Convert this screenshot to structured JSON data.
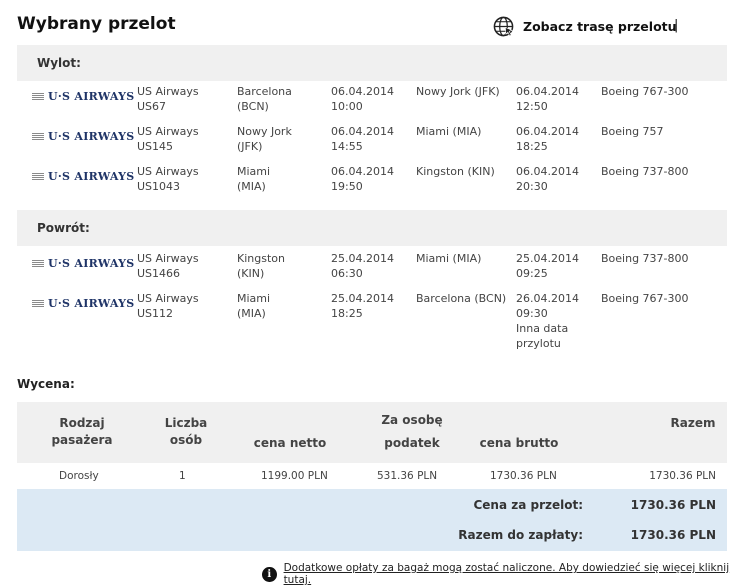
{
  "header": {
    "title": "Wybrany przelot",
    "route_link": "Zobacz trasę przelotu",
    "separator": "|"
  },
  "outbound": {
    "label": "Wylot:",
    "flights": [
      {
        "logo": "U·S AIRWAYS",
        "airline": "US Airways\nUS67",
        "from": "Barcelona\n(BCN)",
        "dep": "06.04.2014\n10:00",
        "to": "Nowy Jork (JFK)",
        "arr": "06.04.2014\n12:50",
        "aircraft": "Boeing 767-300"
      },
      {
        "logo": "U·S AIRWAYS",
        "airline": "US Airways\nUS145",
        "from": "Nowy Jork\n(JFK)",
        "dep": "06.04.2014\n14:55",
        "to": "Miami (MIA)",
        "arr": "06.04.2014\n18:25",
        "aircraft": "Boeing 757"
      },
      {
        "logo": "U·S AIRWAYS",
        "airline": "US Airways\nUS1043",
        "from": "Miami\n(MIA)",
        "dep": "06.04.2014\n19:50",
        "to": "Kingston (KIN)",
        "arr": "06.04.2014\n20:30",
        "aircraft": "Boeing 737-800"
      }
    ]
  },
  "return": {
    "label": "Powrót:",
    "flights": [
      {
        "logo": "U·S AIRWAYS",
        "airline": "US Airways\nUS1466",
        "from": "Kingston\n(KIN)",
        "dep": "25.04.2014\n06:30",
        "to": "Miami (MIA)",
        "arr": "25.04.2014\n09:25",
        "aircraft": "Boeing 737-800"
      },
      {
        "logo": "U·S AIRWAYS",
        "airline": "US Airways\nUS112",
        "from": "Miami\n(MIA)",
        "dep": "25.04.2014\n18:25",
        "to": "Barcelona (BCN)",
        "arr": "26.04.2014\n09:30\nInna data\nprzylotu",
        "aircraft": "Boeing 767-300"
      }
    ]
  },
  "pricing": {
    "label": "Wycena:",
    "headers": {
      "passenger_type": "Rodzaj\npasażera",
      "count": "Liczba\nosób",
      "per_person": "Za osobę",
      "net": "cena netto",
      "tax": "podatek",
      "gross": "cena brutto",
      "total": "Razem"
    },
    "row": {
      "passenger_type": "Dorosły",
      "count": "1",
      "net": "1199.00 PLN",
      "tax": "531.36 PLN",
      "gross": "1730.36 PLN",
      "total": "1730.36 PLN"
    },
    "flight_price_label": "Cena za przelot:",
    "flight_price_value": "1730.36 PLN",
    "to_pay_label": "Razem do zapłaty:",
    "to_pay_value": "1730.36 PLN"
  },
  "footer": {
    "info_icon_glyph": "i",
    "note": "Dodatkowe opłaty za bagaż mogą zostać naliczone. Aby dowiedzieć się więcej kliknij tutaj."
  }
}
